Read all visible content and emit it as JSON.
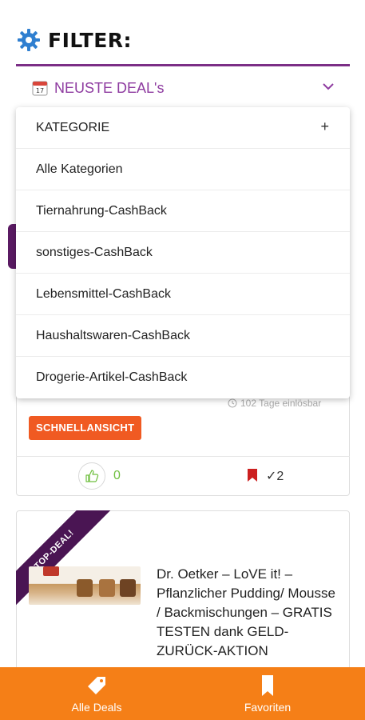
{
  "filter": {
    "title": "FILTER:",
    "sort_label": "NEUSTE DEAL's",
    "accent_color": "#7b2e86"
  },
  "dropdown": {
    "header": "KATEGORIE",
    "plus": "+",
    "items": [
      "Alle Kategorien",
      "Tiernahrung-CashBack",
      "sonstiges-CashBack",
      "Lebensmittel-CashBack",
      "Haushaltswaren-CashBack",
      "Drogerie-Artikel-CashBack"
    ]
  },
  "deal_card": {
    "days_remaining": "102 Tage einlösbar",
    "quick_view_label": "SCHNELLANSICHT",
    "likes": "0",
    "saves": "✓2"
  },
  "top_deal": {
    "ribbon": "TOP-DEAL!",
    "title": "Dr. Oetker – LoVE it! – Pflanzlicher Pudding/ Mousse / Backmischungen – GRATIS TESTEN dank GELD-ZURÜCK-AKTION"
  },
  "bottom_nav": {
    "all_deals": "Alle Deals",
    "favorites": "Favoriten",
    "bar_color": "#f57f17"
  },
  "icons": [
    "gear-icon",
    "calendar-icon",
    "chevron-down-icon",
    "clock-icon",
    "thumbs-up-icon",
    "bookmark-icon",
    "tag-icon",
    "favorites-bookmark-icon"
  ]
}
